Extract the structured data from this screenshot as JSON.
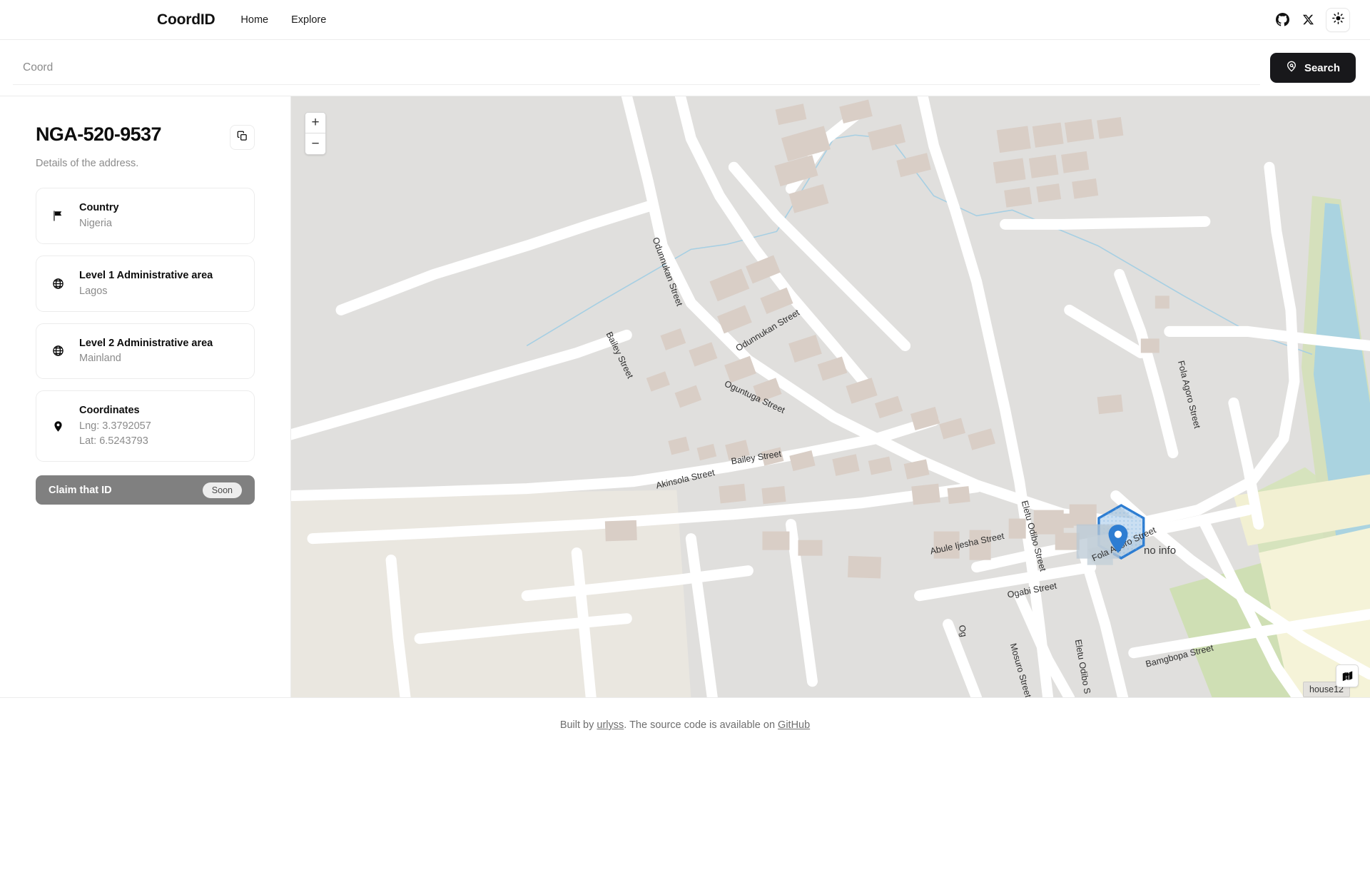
{
  "header": {
    "brand": "CoordID",
    "nav": [
      {
        "label": "Home",
        "name": "nav-home"
      },
      {
        "label": "Explore",
        "name": "nav-explore"
      }
    ],
    "icons": {
      "github": "github-icon",
      "x": "x-twitter-icon",
      "theme": "sun-theme-toggle-icon"
    }
  },
  "search": {
    "placeholder": "Coord",
    "value": "",
    "button_label": "Search",
    "button_icon": "map-pin-search-icon"
  },
  "sidebar": {
    "title": "NGA-520-9537",
    "subtitle": "Details of the address.",
    "copy_icon": "copy-icon",
    "cards": [
      {
        "icon": "flag-icon",
        "label": "Country",
        "value": "Nigeria"
      },
      {
        "icon": "globe-icon",
        "label": "Level 1 Administrative area",
        "value": "Lagos"
      },
      {
        "icon": "globe-icon",
        "label": "Level 2 Administrative area",
        "value": "Mainland"
      },
      {
        "icon": "map-pin-icon",
        "label": "Coordinates",
        "value": "Lng: 3.3792057",
        "value2": "Lat: 6.5243793"
      }
    ],
    "claim": {
      "label": "Claim that ID",
      "badge": "Soon"
    }
  },
  "map": {
    "zoom_in": "+",
    "zoom_out": "−",
    "layers_icon": "map-layers-icon",
    "marker_icon": "map-pin-marker",
    "feature_label": "no info",
    "building_tooltip": "house12",
    "accent": "#2d7dd2",
    "highlight_fill": "#9fc4e8",
    "streets": [
      "Odunnukan Street",
      "Odunnukan Street",
      "Bailey Street",
      "Bailey Street",
      "Oguntuga Street",
      "Akinsola Street",
      "Abule Ijesha Street",
      "Eletu Odibo Street",
      "Eletu Odibo Street",
      "Fola Agoro Street",
      "Fola Agoro Street",
      "Ogabi Street",
      "Mosuro Street",
      "Bamgbopa Street"
    ]
  },
  "footer": {
    "prefix": "Built by ",
    "author": "urlyss",
    "middle": ". The source code is available on ",
    "source": "GitHub"
  }
}
